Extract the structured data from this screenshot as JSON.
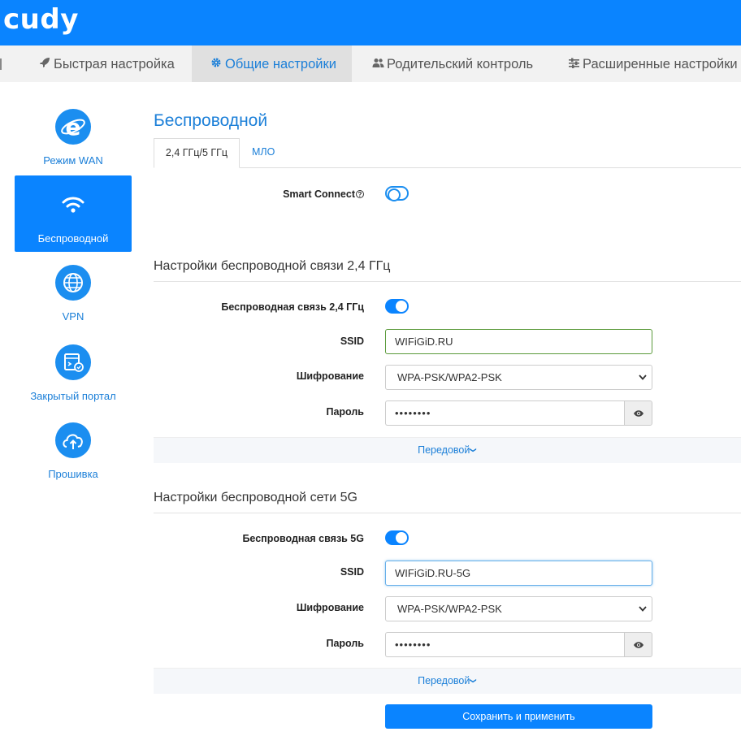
{
  "header": {
    "logo": "cudy",
    "brand_color": "#0a84ff"
  },
  "nav": {
    "items": [
      {
        "label": "Быстрая настройка",
        "icon": "rocket-icon"
      },
      {
        "label": "Общие настройки",
        "icon": "gear-icon"
      },
      {
        "label": "Родительский контроль",
        "icon": "users-icon"
      },
      {
        "label": "Расширенные настройки",
        "icon": "sliders-icon"
      }
    ],
    "active": "Общие настройки"
  },
  "sidebar": {
    "items": [
      {
        "label": "Режим WAN",
        "icon": "internet-explorer-icon"
      },
      {
        "label": "Беспроводной",
        "icon": "wifi-icon"
      },
      {
        "label": "VPN",
        "icon": "globe-icon"
      },
      {
        "label": "Закрытый портал",
        "icon": "portal-icon"
      },
      {
        "label": "Прошивка",
        "icon": "cloud-upload-icon"
      }
    ],
    "active": "Беспроводной"
  },
  "main": {
    "title": "Беспроводной",
    "tabs": [
      {
        "label": "2,4 ГГц/5 ГГц"
      },
      {
        "label": "МЛО"
      }
    ],
    "smart_connect": {
      "label": "Smart Connect",
      "help_glyph": "?",
      "enabled": false
    },
    "band24": {
      "section_title": "Настройки беспроводной связи 2,4 ГГц",
      "toggle_label": "Беспроводная связь 2,4 ГГц",
      "enabled": true,
      "ssid_label": "SSID",
      "ssid_value": "WIFiGiD.RU",
      "encryption_label": "Шифрование",
      "encryption_value": "WPA-PSK/WPA2-PSK",
      "password_label": "Пароль",
      "password_value": "••••••••",
      "advanced_label": "Передовой"
    },
    "band5": {
      "section_title": "Настройки беспроводной сети 5G",
      "toggle_label": "Беспроводная связь 5G",
      "enabled": true,
      "ssid_label": "SSID",
      "ssid_value": "WIFiGiD.RU-5G",
      "encryption_label": "Шифрование",
      "encryption_value": "WPA-PSK/WPA2-PSK",
      "password_label": "Пароль",
      "password_value": "••••••••",
      "advanced_label": "Передовой"
    },
    "save_label": "Сохранить и применить"
  }
}
